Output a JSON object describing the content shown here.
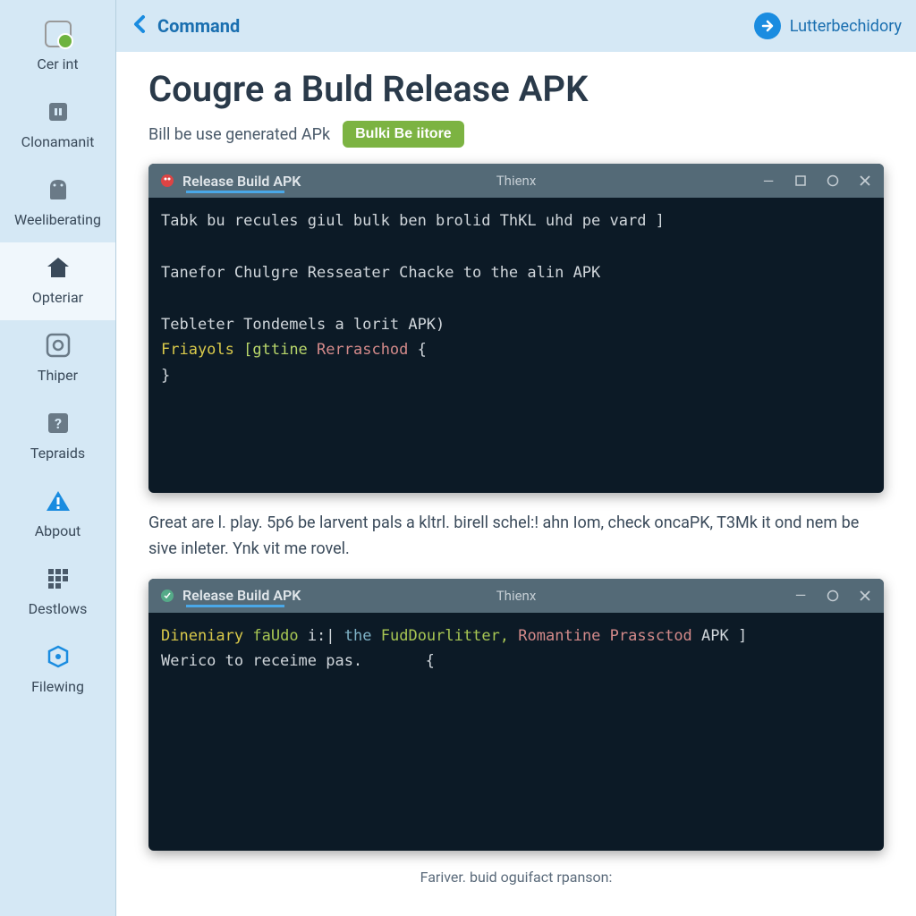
{
  "sidebar": {
    "items": [
      {
        "label": "Cer int"
      },
      {
        "label": "Clonamanit"
      },
      {
        "label": "Weeliberating"
      },
      {
        "label": "Opteriar"
      },
      {
        "label": "Thiper"
      },
      {
        "label": "Tepraids"
      },
      {
        "label": "Abpout"
      },
      {
        "label": "Destlows"
      },
      {
        "label": "Filewing"
      }
    ]
  },
  "topbar": {
    "back_label": "Command",
    "forward_label": "Lutterbechidory"
  },
  "page": {
    "title": "Cougre a Buld Release APK",
    "subtitle": "Bill be use generated APk",
    "button": "Bulki Be iitore"
  },
  "terminal1": {
    "title": "Release Build APK",
    "center": "Thienx",
    "lines": {
      "l1": "Tabk bu recules giul bulk ben brolid ThKL uhd pe vard ]",
      "l2": "Tanefor Chulgre Resseater Chacke to the alin APK",
      "l3": "Tebleter Tondemels a lorit APK)",
      "l4a": "Friayols",
      "l4b": "[gttine",
      "l4c": "Rerraschod",
      "l4d": "{",
      "l5": "}"
    }
  },
  "body_text": "Great are l. play. 5p6 be larvent pals a kltrl. birell schel:! ahn Iom, check oncaPK, T3Mk it ond nem be sive inleter. Ynk vit me rovel.",
  "terminal2": {
    "title": "Release Build APK",
    "center": "Thienx",
    "lines": {
      "l1a": "Dineniary",
      "l1b": "faUdo",
      "l1c": "i:|",
      "l1d": "the",
      "l1e": "FudDourlitter,",
      "l1f": "Romantine",
      "l1g": "Prassctod",
      "l1h": "APK ]",
      "l2a": "Werico to receime pas.",
      "l2b": "{"
    }
  },
  "footer": "Fariver. buid oguifact rpanson:"
}
